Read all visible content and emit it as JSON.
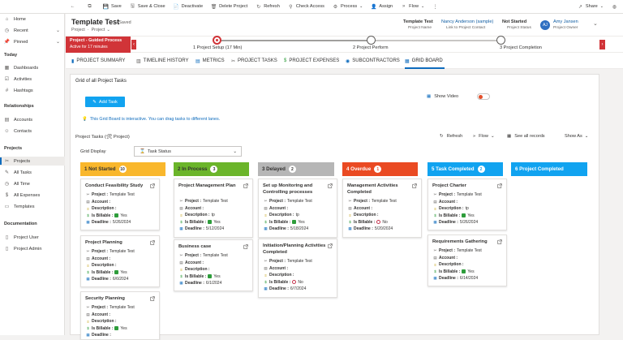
{
  "toolbar": {
    "save": "Save",
    "save_close": "Save & Close",
    "deactivate": "Deactivate",
    "delete": "Delete Project",
    "refresh": "Refresh",
    "check_access": "Check Access",
    "process": "Process",
    "assign": "Assign",
    "flow": "Flow",
    "share": "Share"
  },
  "sidebar": {
    "home": "Home",
    "recent": "Recent",
    "pinned": "Pinned",
    "today_head": "Today",
    "dashboards": "Dashboards",
    "activities": "Activities",
    "hashtags": "Hashtags",
    "relationships_head": "Relationships",
    "accounts": "Accounts",
    "contacts": "Contacts",
    "projects_head": "Projects",
    "projects": "Projects",
    "all_tasks": "All Tasks",
    "all_time": "All Time",
    "all_expenses": "All Expenses",
    "templates": "Templates",
    "documentation_head": "Documentation",
    "project_user": "Project User",
    "project_admin": "Project Admin"
  },
  "header": {
    "title": "Template Test",
    "saved": "- Saved",
    "breadcrumb": "Project",
    "breadcrumb_sep": "·",
    "breadcrumb_sub": "Project",
    "field1_value": "Template Test",
    "field1_label": "Project Name",
    "field2_value": "Nancy Anderson (sample)",
    "field2_label": "Link to Project Contact",
    "field3_value": "Not Started",
    "field3_label": "Project Status",
    "avatar": "AJ",
    "owner_name": "Amy Jansen",
    "owner_label": "Project Owner"
  },
  "bpf": {
    "active_title": "Project - Guided Process",
    "active_sub": "Active for 17 minutes",
    "stage1": "1 Project Setup",
    "stage1_time": "(17 Min)",
    "stage2": "2 Project Perform",
    "stage3": "3 Project Completion"
  },
  "tabs": [
    {
      "label": "PROJECT SUMMARY"
    },
    {
      "label": "TIMELINE HISTORY"
    },
    {
      "label": "METRICS"
    },
    {
      "label": "PROJECT TASKS"
    },
    {
      "label": "PROJECT EXPENSES"
    },
    {
      "label": "SUBCONTRACTORS"
    },
    {
      "label": "GRID BOARD"
    }
  ],
  "grid": {
    "section_title": "Grid of all Project Tasks",
    "add_task": "Add Task",
    "show_video": "Show Video",
    "hint": "This Grid Board is interactive. You can drag tasks to different lanes.",
    "subgrid_title": "Project Tasks (🛠 Project)",
    "refresh": "Refresh",
    "flow": "Flow",
    "see_all": "See all records",
    "show_as": "Show As",
    "grid_display_label": "Grid Display",
    "grid_display_value": "Task Status"
  },
  "colors": {
    "not_started": "#f9b72c",
    "in_process": "#6bb52a",
    "delayed": "#b6b6b6",
    "overdue": "#ea4a22",
    "task_completed": "#11a3f0",
    "project_completed": "#11a3f0",
    "accent": "#0f6cbd"
  },
  "field_labels": {
    "project": "Project :",
    "account": "Account :",
    "description": "Description :",
    "billable": "Is Billable :",
    "deadline": "Deadline :"
  },
  "lanes": [
    {
      "title": "1 Not Started",
      "count": "10"
    },
    {
      "title": "2 In Process",
      "count": "3"
    },
    {
      "title": "3 Delayed",
      "count": "2"
    },
    {
      "title": "4 Overdue",
      "count": "1"
    },
    {
      "title": "5 Task Completed",
      "count": "2"
    },
    {
      "title": "6 Project Completed",
      "count": ""
    }
  ],
  "cards": {
    "c1": {
      "title": "Conduct Feasibility Study",
      "project": "Template Test",
      "account": "",
      "description": "",
      "billable": "Yes",
      "deadline": "5/26/2024"
    },
    "c2": {
      "title": "Project Planning",
      "project": "Template Test",
      "account": "",
      "description": "",
      "billable": "Yes",
      "deadline": "6/6/2024"
    },
    "c3": {
      "title": "Security Planning",
      "project": "Template Test",
      "account": "",
      "description": "",
      "billable": "Yes",
      "deadline": ""
    },
    "c4": {
      "title": "Project Management Plan",
      "project": "Template Test",
      "account": "",
      "description": "tp",
      "billable": "Yes",
      "deadline": "5/12/2024"
    },
    "c5": {
      "title": "Business case",
      "project": "Template Test",
      "account": "",
      "description": "",
      "billable": "Yes",
      "deadline": "6/1/2024"
    },
    "c6": {
      "title": "Set up Monitoring and Controlling processes",
      "project": "Template Test",
      "account": "",
      "description": "tp",
      "billable": "Yes",
      "deadline": "5/18/2024"
    },
    "c7": {
      "title": "Initiation/Planning Activities Completed",
      "project": "Template Test",
      "account": "",
      "description": "",
      "billable": "No",
      "deadline": "6/7/2024"
    },
    "c8": {
      "title": "Management Activities Completed",
      "project": "Template Test",
      "account": "",
      "description": "",
      "billable": "No",
      "deadline": "5/20/2024"
    },
    "c9": {
      "title": "Project Charter",
      "project": "Template Test",
      "account": "",
      "description": "tp",
      "billable": "Yes",
      "deadline": "5/26/2024"
    },
    "c10": {
      "title": "Requirements Gathering",
      "project": "Template Test",
      "account": "",
      "description": "",
      "billable": "Yes",
      "deadline": "6/14/2024"
    }
  }
}
